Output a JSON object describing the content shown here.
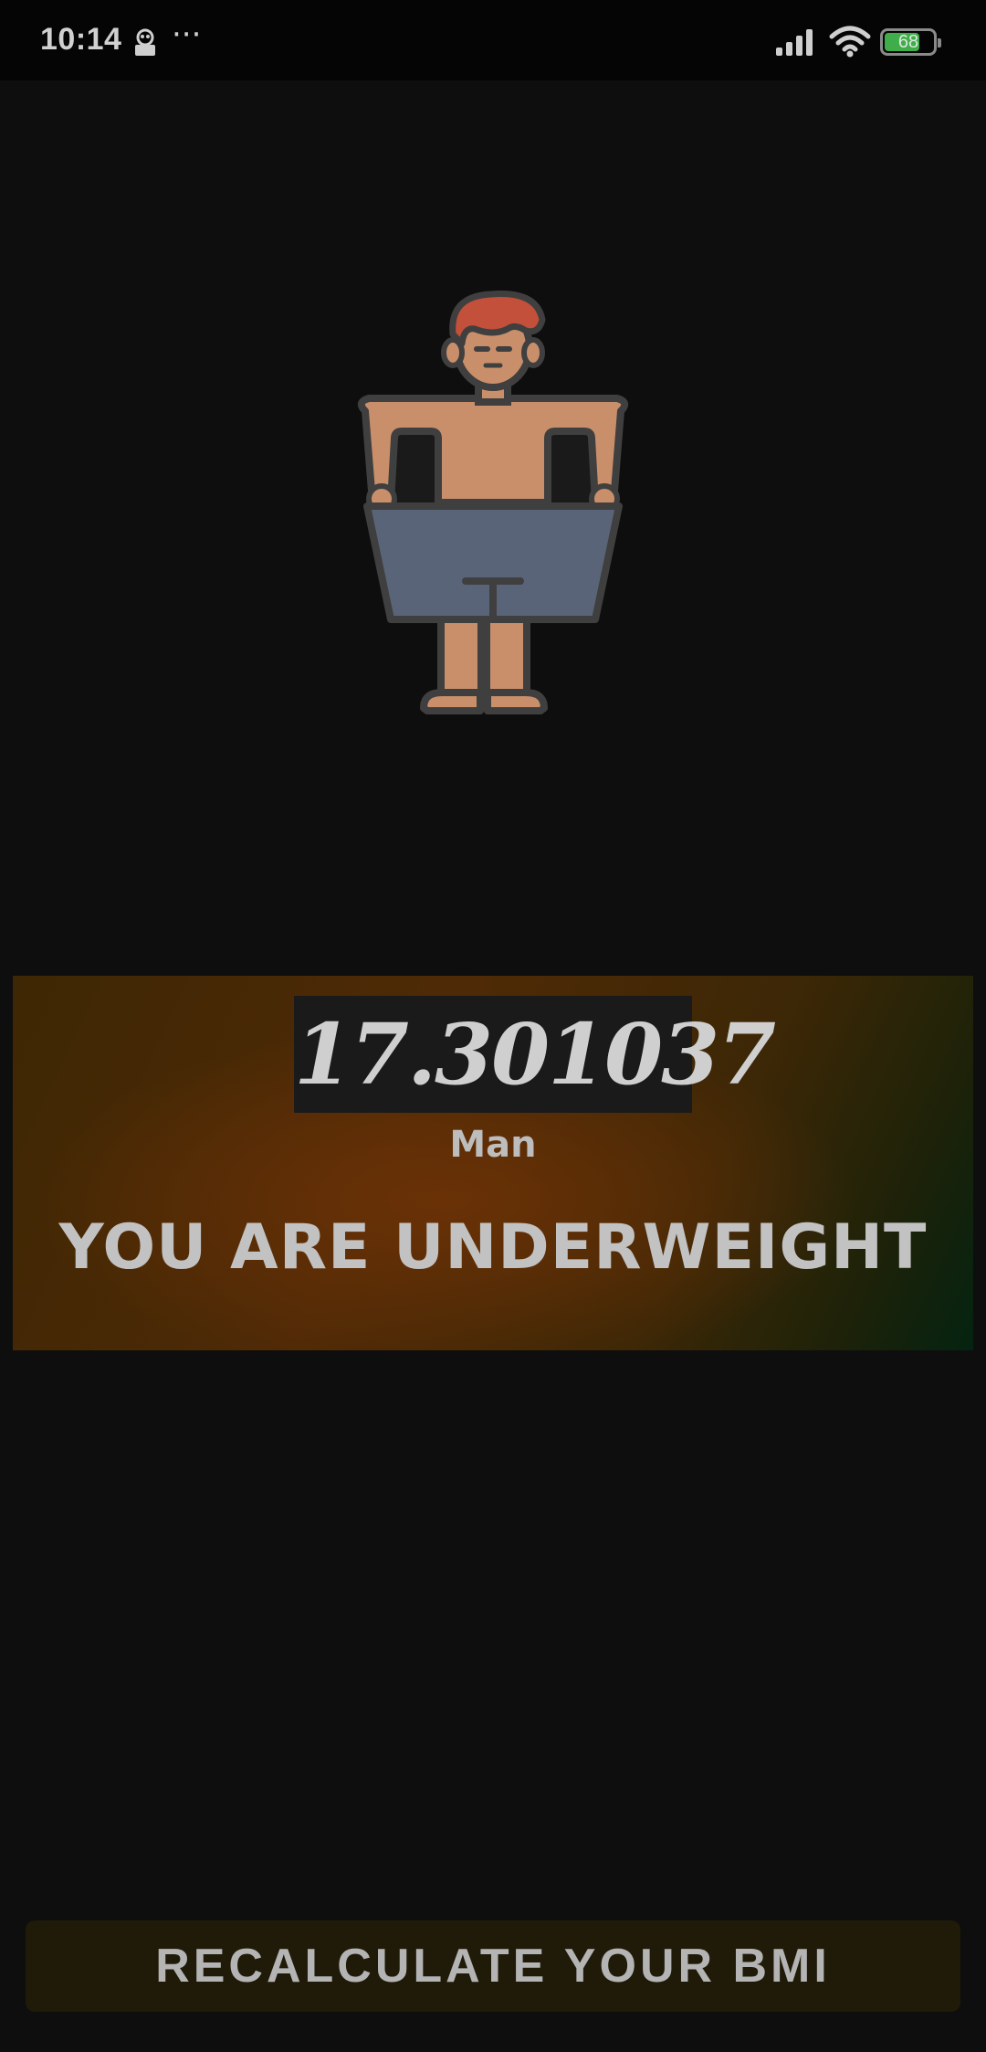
{
  "status_bar": {
    "time": "10:14",
    "more": "···",
    "battery_level": "68",
    "icons": [
      "app-notification-icon",
      "signal-icon",
      "wifi-icon",
      "battery-icon"
    ]
  },
  "illustration": {
    "icon": "man-figure-icon",
    "colors": {
      "hair": "#c2503a",
      "skin": "#c98f6b",
      "shorts": "#5a6478",
      "outline": "#3f3f3f"
    }
  },
  "result": {
    "bmi_value": "17.301037",
    "gender": "Man",
    "message": "YOU ARE UNDERWEIGHT"
  },
  "actions": {
    "recalculate_label": "RECALCULATE YOUR BMI"
  },
  "colors": {
    "background": "#0e0e0e",
    "panel_warm": "#5a2e06",
    "panel_green": "#042310",
    "button_bg": "#201a08"
  }
}
